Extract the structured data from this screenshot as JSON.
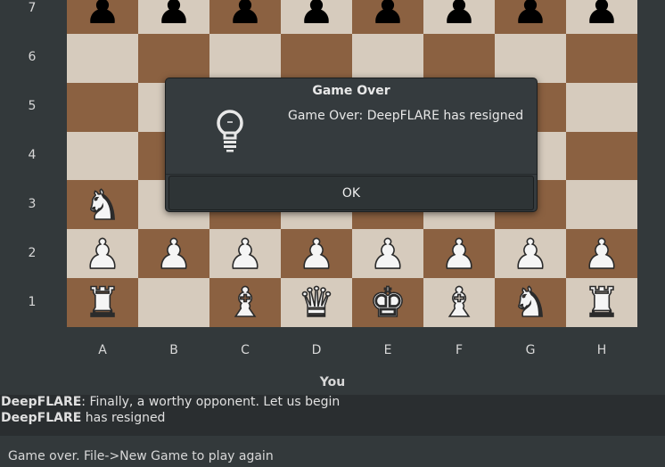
{
  "ranks": [
    "7",
    "6",
    "5",
    "4",
    "3",
    "2",
    "1"
  ],
  "files": [
    "A",
    "B",
    "C",
    "D",
    "E",
    "F",
    "G",
    "H"
  ],
  "board": [
    [
      "bp",
      "bp",
      "bp",
      "bp",
      "bp",
      "bp",
      "bp",
      "bp"
    ],
    [
      "",
      "",
      "",
      "",
      "",
      "",
      "",
      ""
    ],
    [
      "",
      "",
      "",
      "",
      "",
      "",
      "",
      ""
    ],
    [
      "",
      "",
      "",
      "",
      "",
      "",
      "",
      ""
    ],
    [
      "wn",
      "",
      "",
      "",
      "",
      "",
      "",
      ""
    ],
    [
      "wp",
      "wp",
      "wp",
      "wp",
      "wp",
      "wp",
      "wp",
      "wp"
    ],
    [
      "wr",
      "",
      "wb",
      "wq",
      "wk",
      "wb",
      "wn",
      "wr"
    ]
  ],
  "colors": {
    "light_square": "#d6cbbd",
    "dark_square": "#8b6141",
    "background": "#33393b"
  },
  "player_label": "You",
  "chat": [
    {
      "name": "DeepFLARE",
      "text": ": Finally, a worthy opponent. Let us begin"
    },
    {
      "name": "DeepFLARE",
      "text": " has resigned"
    }
  ],
  "status": "Game over. File->New Game to play again",
  "dialog": {
    "title": "Game Over",
    "icon": "lightbulb-icon",
    "message": "Game Over: DeepFLARE has resigned",
    "ok_label": "OK"
  }
}
